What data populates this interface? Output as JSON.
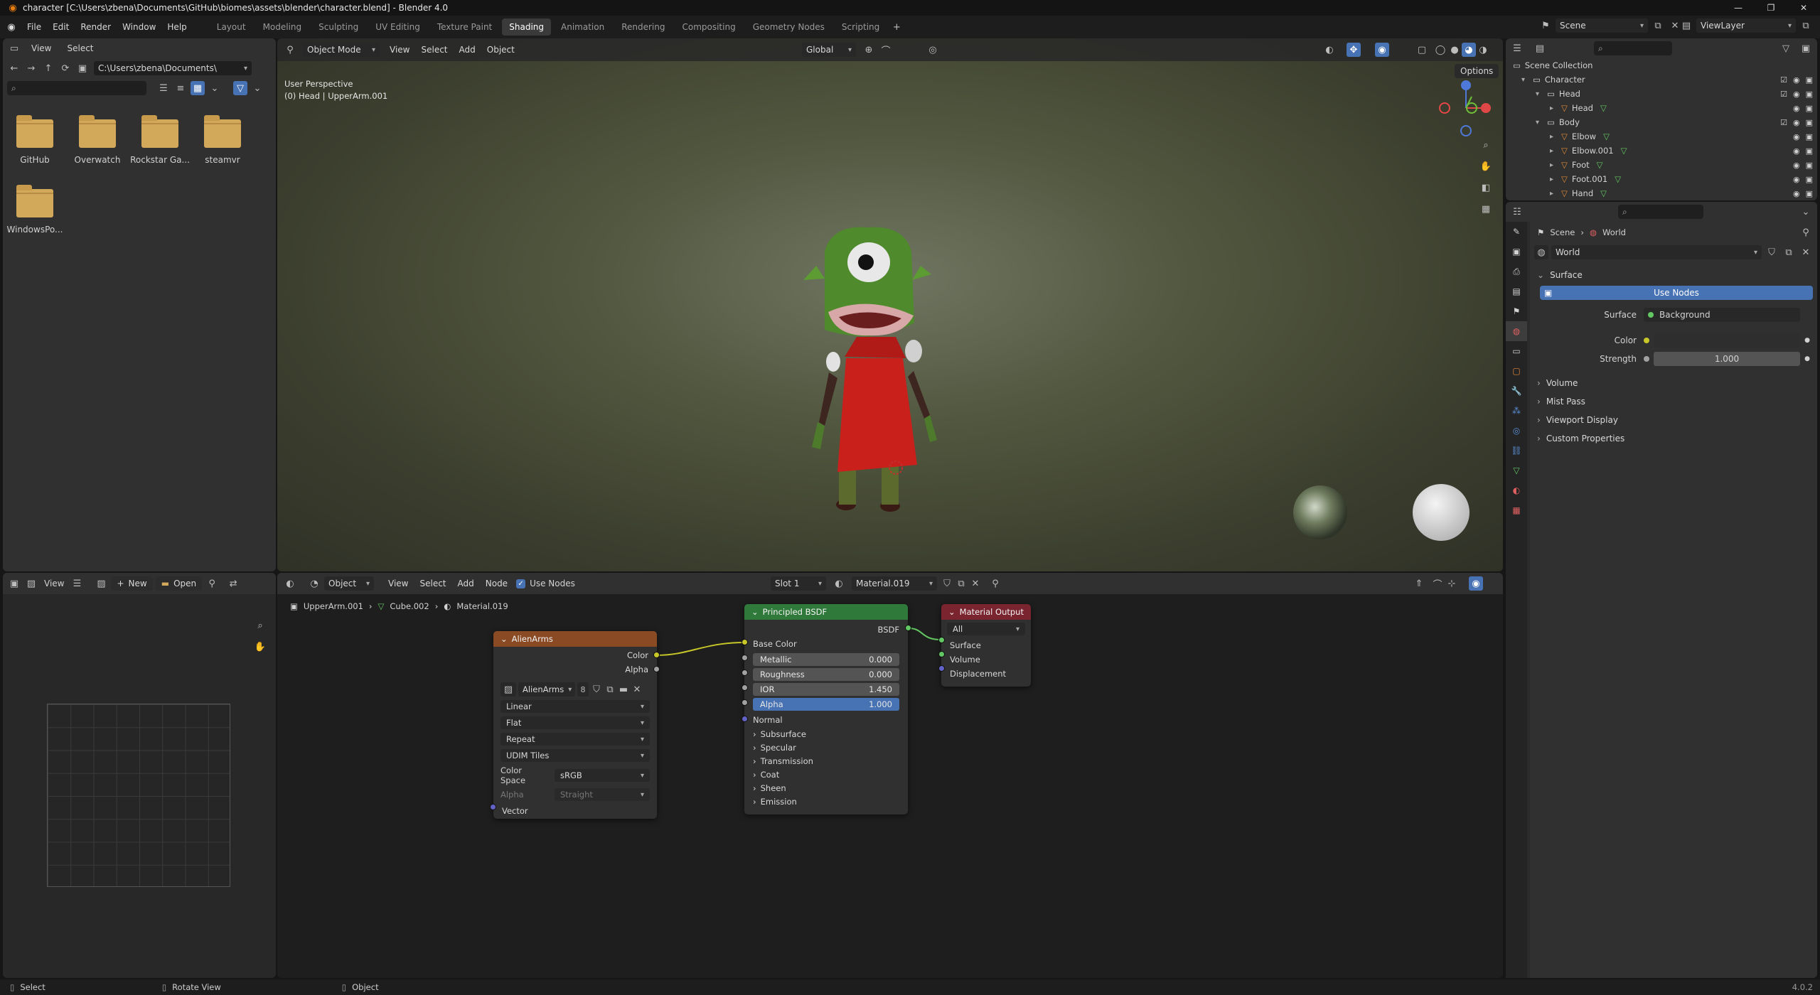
{
  "window": {
    "title": "character [C:\\Users\\zbena\\Documents\\GitHub\\biomes\\assets\\blender\\character.blend] - Blender 4.0"
  },
  "menu": [
    "File",
    "Edit",
    "Render",
    "Window",
    "Help"
  ],
  "workspaces": [
    "Layout",
    "Modeling",
    "Sculpting",
    "UV Editing",
    "Texture Paint",
    "Shading",
    "Animation",
    "Rendering",
    "Compositing",
    "Geometry Nodes",
    "Scripting"
  ],
  "active_workspace": "Shading",
  "scene": {
    "name": "Scene",
    "view_layer": "ViewLayer"
  },
  "file_browser": {
    "menu": [
      "View",
      "Select"
    ],
    "path": "C:\\Users\\zbena\\Documents\\",
    "search_placeholder": "",
    "folders": [
      "GitHub",
      "Overwatch",
      "Rockstar Ga...",
      "steamvr",
      "WindowsPo..."
    ]
  },
  "viewport": {
    "mode": "Object Mode",
    "menu": [
      "View",
      "Select",
      "Add",
      "Object"
    ],
    "orientation": "Global",
    "options": "Options",
    "overlay_line1": "User Perspective",
    "overlay_line2": "(0) Head | UpperArm.001"
  },
  "image_editor": {
    "view": "View",
    "new": "New",
    "open": "Open"
  },
  "node_editor": {
    "mode": "Object",
    "menu": [
      "View",
      "Select",
      "Add",
      "Node"
    ],
    "use_nodes": "Use Nodes",
    "slot": "Slot 1",
    "material": "Material.019",
    "breadcrumb": [
      "UpperArm.001",
      "Cube.002",
      "Material.019"
    ],
    "image_node": {
      "title": "AlienArms",
      "out_color": "Color",
      "out_alpha": "Alpha",
      "image_name": "AlienArms",
      "users": "8",
      "interpolation": "Linear",
      "projection": "Flat",
      "extension": "Repeat",
      "source": "UDIM Tiles",
      "color_space_label": "Color Space",
      "color_space": "sRGB",
      "alpha_label": "Alpha",
      "alpha_mode": "Straight",
      "in_vector": "Vector"
    },
    "bsdf_node": {
      "title": "Principled BSDF",
      "out_bsdf": "BSDF",
      "base_color": "Base Color",
      "fields": [
        {
          "label": "Metallic",
          "value": "0.000"
        },
        {
          "label": "Roughness",
          "value": "0.000"
        },
        {
          "label": "IOR",
          "value": "1.450"
        },
        {
          "label": "Alpha",
          "value": "1.000"
        }
      ],
      "normal": "Normal",
      "panels": [
        "Subsurface",
        "Specular",
        "Transmission",
        "Coat",
        "Sheen",
        "Emission"
      ]
    },
    "output_node": {
      "title": "Material Output",
      "target": "All",
      "inputs": [
        "Surface",
        "Volume",
        "Displacement"
      ]
    }
  },
  "outliner": {
    "root": "Scene Collection",
    "rows": [
      {
        "name": "Character",
        "depth": 0,
        "kind": "collection"
      },
      {
        "name": "Head",
        "depth": 1,
        "kind": "collection"
      },
      {
        "name": "Head",
        "depth": 2,
        "kind": "object"
      },
      {
        "name": "Body",
        "depth": 1,
        "kind": "collection"
      },
      {
        "name": "Elbow",
        "depth": 2,
        "kind": "object"
      },
      {
        "name": "Elbow.001",
        "depth": 2,
        "kind": "object"
      },
      {
        "name": "Foot",
        "depth": 2,
        "kind": "object"
      },
      {
        "name": "Foot.001",
        "depth": 2,
        "kind": "object"
      },
      {
        "name": "Hand",
        "depth": 2,
        "kind": "object"
      }
    ]
  },
  "properties": {
    "breadcrumb": [
      "Scene",
      "World"
    ],
    "world_name": "World",
    "surface_section": "Surface",
    "use_nodes": "Use Nodes",
    "surface_label": "Surface",
    "surface_value": "Background",
    "color_label": "Color",
    "strength_label": "Strength",
    "strength_value": "1.000",
    "sections": [
      "Volume",
      "Mist Pass",
      "Viewport Display",
      "Custom Properties"
    ]
  },
  "status": {
    "select": "Select",
    "rotate": "Rotate View",
    "object": "Object",
    "version": "4.0.2"
  },
  "colors": {
    "accent_blue": "#4772b3",
    "image_node_header": "#8a4a24",
    "bsdf_node_header": "#2f7a3a",
    "output_node_header": "#7a2430",
    "socket_yellow": "#c7c729",
    "socket_gray": "#a1a1a1",
    "socket_green": "#63c763",
    "socket_purple": "#6363c7"
  }
}
